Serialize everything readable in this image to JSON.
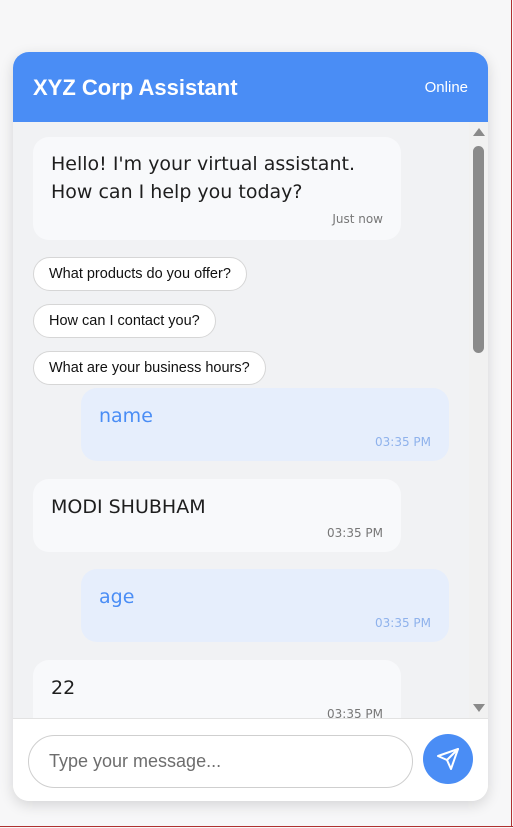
{
  "header": {
    "title": "XYZ Corp Assistant",
    "status": "Online"
  },
  "welcome": {
    "text": "Hello! I'm your virtual assistant. How can I help you today?",
    "time": "Just now"
  },
  "suggestions": [
    "What products do you offer?",
    "How can I contact you?",
    "What are your business hours?"
  ],
  "messages": [
    {
      "sender": "user",
      "text": "name",
      "time": "03:35 PM"
    },
    {
      "sender": "bot",
      "text": "MODI SHUBHAM",
      "time": "03:35 PM"
    },
    {
      "sender": "user",
      "text": "age",
      "time": "03:35 PM"
    },
    {
      "sender": "bot",
      "text": "22",
      "time": "03:35 PM"
    }
  ],
  "input": {
    "placeholder": "Type your message..."
  },
  "icons": {
    "send": "send-icon"
  },
  "colors": {
    "accent": "#4a8df5",
    "user_bubble": "#e6eefc",
    "bot_bubble": "#f8f9fb"
  }
}
